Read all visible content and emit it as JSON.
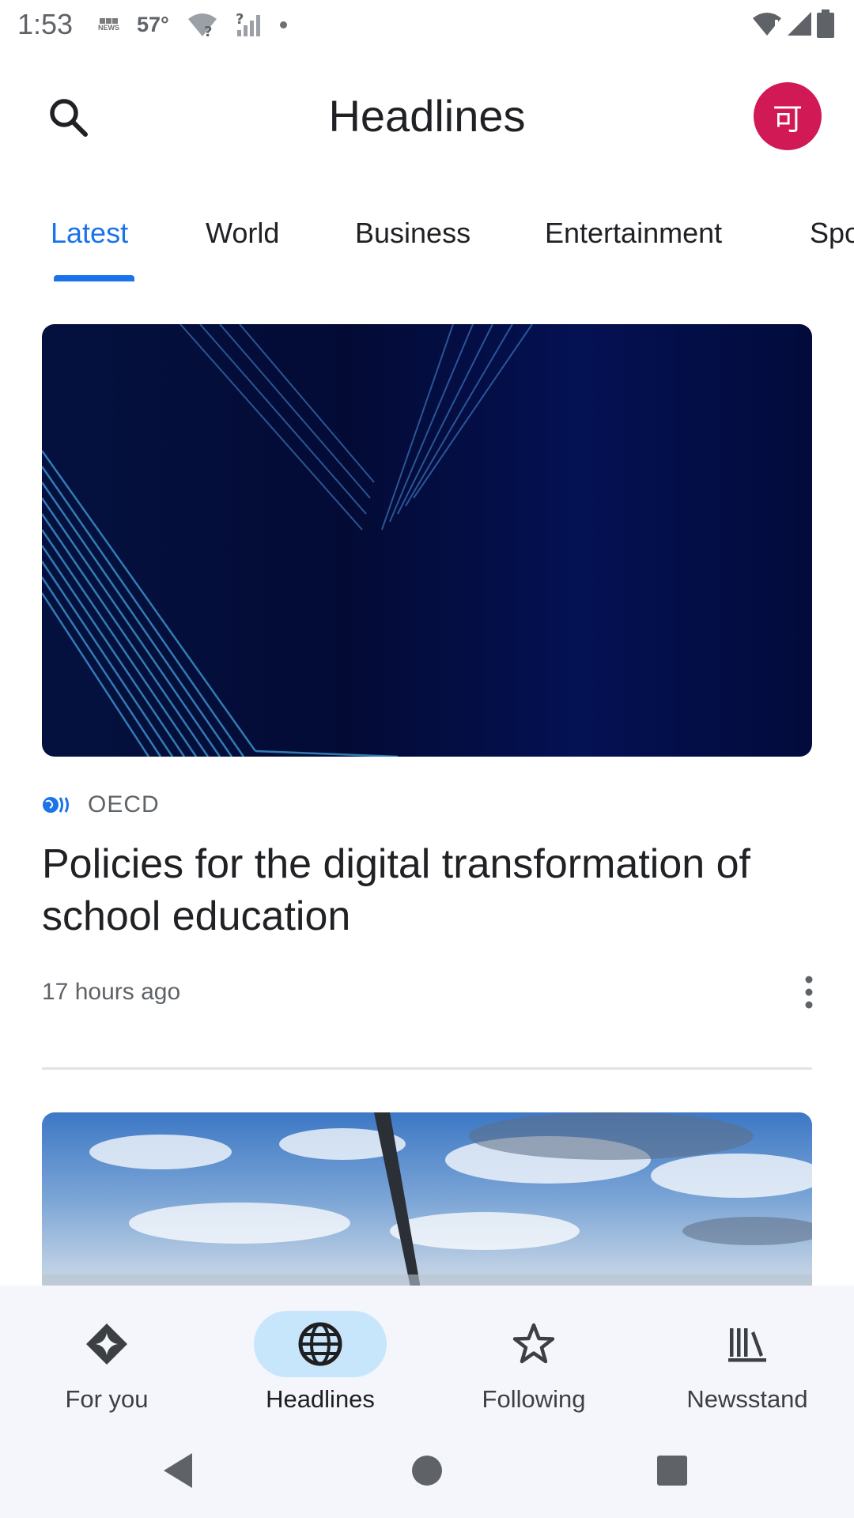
{
  "status_bar": {
    "time": "1:53",
    "bbc_label": "NEWS",
    "temperature": "57°",
    "left_icons": [
      "bbc-news-icon",
      "wifi-question-icon",
      "signal-question-icon",
      "dot-icon"
    ],
    "right_icons": [
      "wifi-alert-icon",
      "cell-signal-icon",
      "battery-icon"
    ]
  },
  "header": {
    "title": "Headlines",
    "avatar_initial": "可",
    "search_icon": "search-icon"
  },
  "tabs": [
    {
      "label": "Latest",
      "active": true
    },
    {
      "label": "World",
      "active": false
    },
    {
      "label": "Business",
      "active": false
    },
    {
      "label": "Entertainment",
      "active": false
    },
    {
      "label": "Spo",
      "active": false
    }
  ],
  "article1": {
    "source": "OECD",
    "headline": "Policies for the digital transformation of school education",
    "time": "17 hours ago",
    "more_icon": "more-vert-icon"
  },
  "bottom_nav": [
    {
      "label": "For you",
      "icon": "for-you-icon",
      "active": false
    },
    {
      "label": "Headlines",
      "icon": "globe-icon",
      "active": true
    },
    {
      "label": "Following",
      "icon": "star-icon",
      "active": false
    },
    {
      "label": "Newsstand",
      "icon": "newsstand-icon",
      "active": false
    }
  ],
  "system_nav": [
    "back-icon",
    "home-icon",
    "recents-icon"
  ],
  "colors": {
    "accent": "#1a73e8",
    "avatar": "#d11a55",
    "nav_active_pill": "#c8e6fb",
    "nav_background": "#f4f6fb"
  }
}
